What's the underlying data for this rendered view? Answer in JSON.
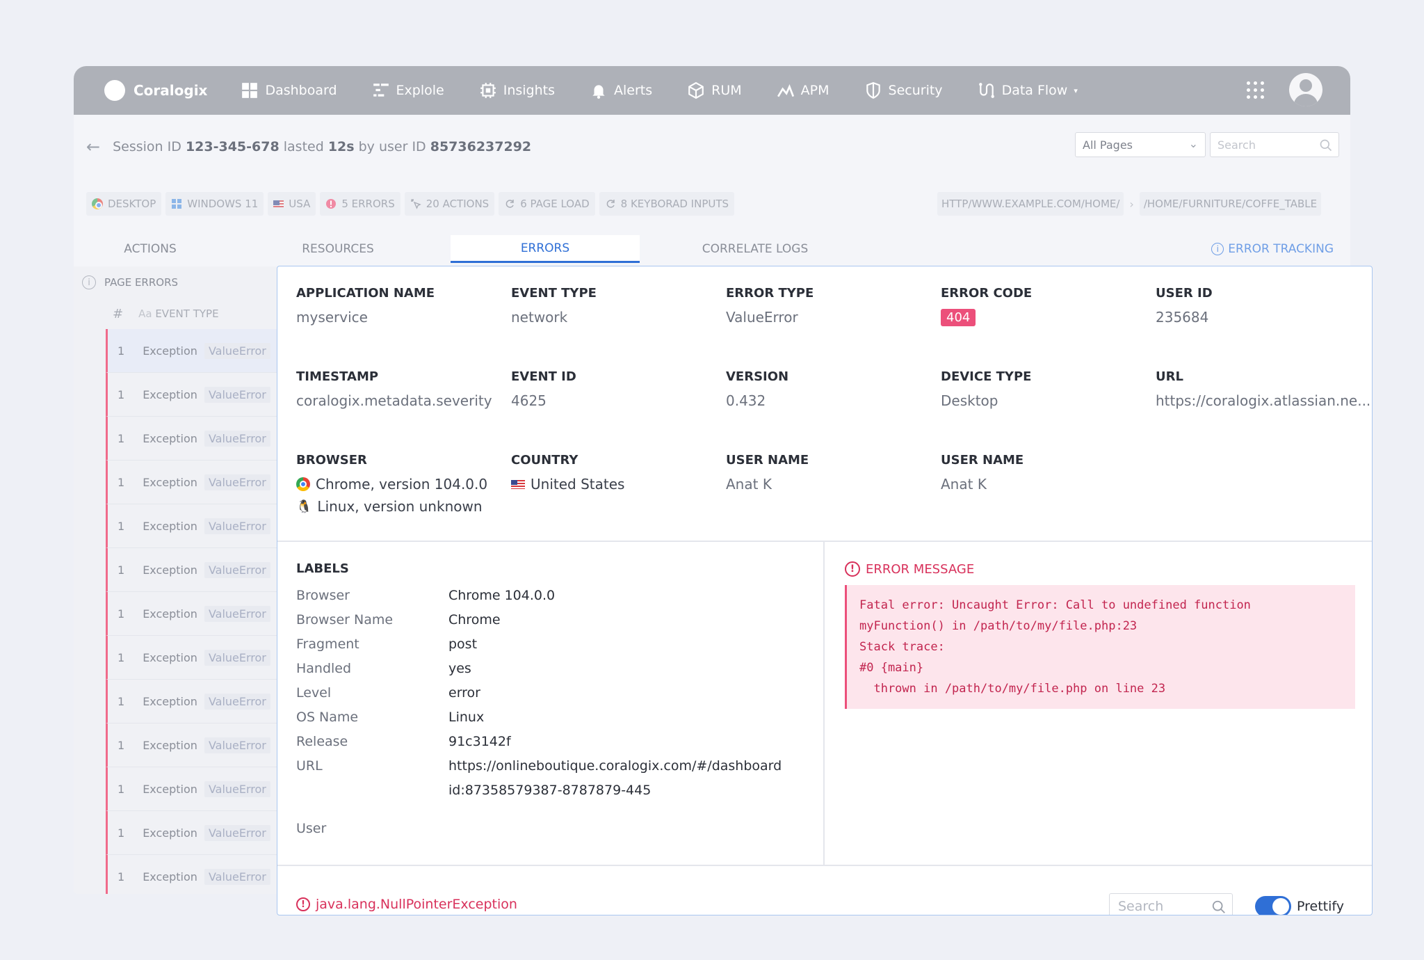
{
  "nav": {
    "brand": "Coralogix",
    "items": [
      {
        "label": "Dashboard",
        "icon": "dashboard-icon"
      },
      {
        "label": "Explole",
        "icon": "explore-icon"
      },
      {
        "label": "Insights",
        "icon": "insights-icon"
      },
      {
        "label": "Alerts",
        "icon": "bell-icon"
      },
      {
        "label": "RUM",
        "icon": "rum-icon"
      },
      {
        "label": "APM",
        "icon": "apm-icon"
      },
      {
        "label": "Security",
        "icon": "shield-icon"
      },
      {
        "label": "Data Flow",
        "icon": "data-flow-icon"
      }
    ]
  },
  "session": {
    "prefix": "Session ID",
    "id": "123-345-678",
    "lasted_word": "lasted",
    "duration": "12s",
    "by_user": "by user ID",
    "user_id": "85736237292"
  },
  "filters": {
    "pages_value": "All Pages",
    "search_placeholder": "Search"
  },
  "chips": [
    {
      "label": "DESKTOP",
      "icon": "chrome-icon"
    },
    {
      "label": "WINDOWS 11",
      "icon": "windows-icon"
    },
    {
      "label": "USA",
      "icon": "us-flag-icon"
    },
    {
      "label": "5 ERRORS",
      "icon": "error-icon"
    },
    {
      "label": "20 ACTIONS",
      "icon": "click-icon"
    },
    {
      "label": "6 PAGE LOAD",
      "icon": "refresh-icon"
    },
    {
      "label": "8 KEYBORAD INPUTS",
      "icon": "refresh-icon"
    }
  ],
  "url_chips": [
    "HTTP/WWW.EXAMPLE.COM/HOME/",
    "/HOME/FURNITURE/COFFE_TABLE"
  ],
  "tabs": [
    "ACTIONS",
    "RESOURCES",
    "ERRORS",
    "CORRELATE LOGS"
  ],
  "active_tab": "ERRORS",
  "error_tracking": "ERROR TRACKING",
  "left_list": {
    "title": "PAGE ERRORS",
    "col_hash": "#",
    "col_event_type": "EVENT TYPE",
    "col_prefix": "Aa",
    "rows": [
      {
        "count": "1",
        "type": "Exception",
        "tag": "ValueError"
      },
      {
        "count": "1",
        "type": "Exception",
        "tag": "ValueError"
      },
      {
        "count": "1",
        "type": "Exception",
        "tag": "ValueError"
      },
      {
        "count": "1",
        "type": "Exception",
        "tag": "ValueError"
      },
      {
        "count": "1",
        "type": "Exception",
        "tag": "ValueError"
      },
      {
        "count": "1",
        "type": "Exception",
        "tag": "ValueError"
      },
      {
        "count": "1",
        "type": "Exception",
        "tag": "ValueError"
      },
      {
        "count": "1",
        "type": "Exception",
        "tag": "ValueError"
      },
      {
        "count": "1",
        "type": "Exception",
        "tag": "ValueError"
      },
      {
        "count": "1",
        "type": "Exception",
        "tag": "ValueError"
      },
      {
        "count": "1",
        "type": "Exception",
        "tag": "ValueError"
      },
      {
        "count": "1",
        "type": "Exception",
        "tag": "ValueError"
      },
      {
        "count": "1",
        "type": "Exception",
        "tag": "ValueError"
      }
    ]
  },
  "details": {
    "app_name": {
      "label": "APPLICATION NAME",
      "value": "myservice"
    },
    "event_type": {
      "label": "EVENT TYPE",
      "value": "network"
    },
    "error_type": {
      "label": "ERROR TYPE",
      "value": "ValueError"
    },
    "error_code": {
      "label": "ERROR CODE",
      "value": "404"
    },
    "user_id": {
      "label": "USER ID",
      "value": "235684"
    },
    "timestamp": {
      "label": "TIMESTAMP",
      "value": "coralogix.metadata.severity"
    },
    "event_id": {
      "label": "EVENT ID",
      "value": "4625"
    },
    "version": {
      "label": "VERSION",
      "value": "0.432"
    },
    "device_type": {
      "label": "DEVICE TYPE",
      "value": "Desktop"
    },
    "url": {
      "label": "URL",
      "value": "https://coralogix.atlassian.ne..."
    },
    "browser": {
      "label": "BROWSER",
      "value": "Chrome, version 104.0.0",
      "os": "Linux, version unknown"
    },
    "country": {
      "label": "COUNTRY",
      "value": "United States"
    },
    "user_name_1": {
      "label": "USER NAME",
      "value": "Anat K"
    },
    "user_name_2": {
      "label": "USER NAME",
      "value": "Anat K"
    }
  },
  "labels": {
    "title": "LABELS",
    "rows": [
      {
        "k": "Browser",
        "v": "Chrome 104.0.0"
      },
      {
        "k": "Browser Name",
        "v": "Chrome"
      },
      {
        "k": "Fragment",
        "v": "post"
      },
      {
        "k": "Handled",
        "v": "yes"
      },
      {
        "k": "Level",
        "v": "error"
      },
      {
        "k": "OS Name",
        "v": "Linux"
      },
      {
        "k": "Release",
        "v": "91c3142f"
      },
      {
        "k": "URL",
        "v": "https://onlineboutique.coralogix.com/#/dashboard"
      },
      {
        "k": "",
        "v": "id:87358579387-8787879-445"
      }
    ],
    "user_label": "User"
  },
  "error_message": {
    "title": "ERROR MESSAGE",
    "text": "Fatal error: Uncaught Error: Call to undefined function\nmyFunction() in /path/to/my/file.php:23\nStack trace:\n#0 {main}\n  thrown in /path/to/my/file.php on line 23"
  },
  "bottom": {
    "exception": "java.lang.NullPointerException",
    "search_placeholder": "Search",
    "prettify_label": "Prettify",
    "prettify_on": true
  },
  "colors": {
    "accent": "#2f6fd6",
    "error": "#d8315b",
    "badge": "#ec4f7a",
    "nav_bg": "#aeb1b8"
  }
}
